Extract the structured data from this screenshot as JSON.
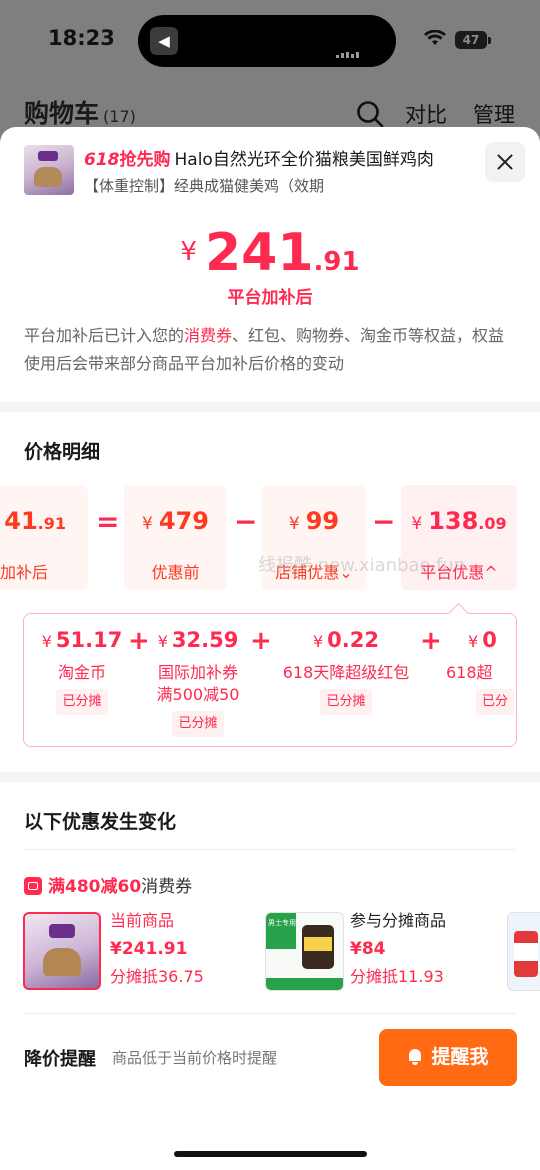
{
  "status_bar": {
    "time": "18:23",
    "battery": "47"
  },
  "background_header": {
    "title": "购物车",
    "count": "(17)",
    "compare": "对比",
    "manage": "管理"
  },
  "product": {
    "promo_618": "618",
    "promo_label": "抢先购",
    "name": "Halo自然光环全价猫粮美国鲜鸡肉",
    "subtitle": "【体重控制】经典成猫健美鸡（效期"
  },
  "price": {
    "currency": "¥",
    "integer": "241",
    "decimal": ".91",
    "label": "平台加补后"
  },
  "notice": {
    "part1": "平台加补后已计入您的",
    "highlight": "消费券",
    "part2": "、红包、购物券、淘金币等权益，权益使用后会带来部分商品平台加补后价格的变动"
  },
  "price_detail": {
    "title": "价格明细",
    "equation": [
      {
        "int": "41",
        "dec": ".91",
        "label": "加补后"
      },
      {
        "op": "="
      },
      {
        "currency": "¥",
        "int": "479",
        "dec": "",
        "label": "优惠前"
      },
      {
        "op": "−"
      },
      {
        "currency": "¥",
        "int": "99",
        "dec": "",
        "label": "店铺优惠⌄"
      },
      {
        "op": "−"
      },
      {
        "currency": "¥",
        "int": "138",
        "dec": ".09",
        "label": "平台优惠^"
      }
    ],
    "watermark": "线报酷 new.xianbao.fun"
  },
  "breakdown": [
    {
      "currency": "¥",
      "value": "51.17",
      "label": "淘金币",
      "tag": "已分摊"
    },
    {
      "currency": "¥",
      "value": "32.59",
      "label": "国际加补券\n满500减50",
      "tag": "已分摊"
    },
    {
      "currency": "¥",
      "value": "0.22",
      "label": "618天降超级红包",
      "tag": "已分摊"
    },
    {
      "currency": "¥",
      "value": "0",
      "label": "618超",
      "tag": "已分"
    }
  ],
  "changes": {
    "title": "以下优惠发生变化",
    "coupon_highlight": "满480减60",
    "coupon_suffix": "消费券",
    "current": {
      "label": "当前商品",
      "price": "¥241.91",
      "share": "分摊抵36.75"
    },
    "other": {
      "label": "参与分摊商品",
      "price": "¥84",
      "share": "分摊抵11.93"
    }
  },
  "reminder": {
    "title": "降价提醒",
    "desc": "商品低于当前价格时提醒",
    "button": "提醒我"
  },
  "colors": {
    "accent_red": "#ff2a4f",
    "accent_orange_red": "#ff3a1f",
    "button_orange": "#ff6a12"
  }
}
